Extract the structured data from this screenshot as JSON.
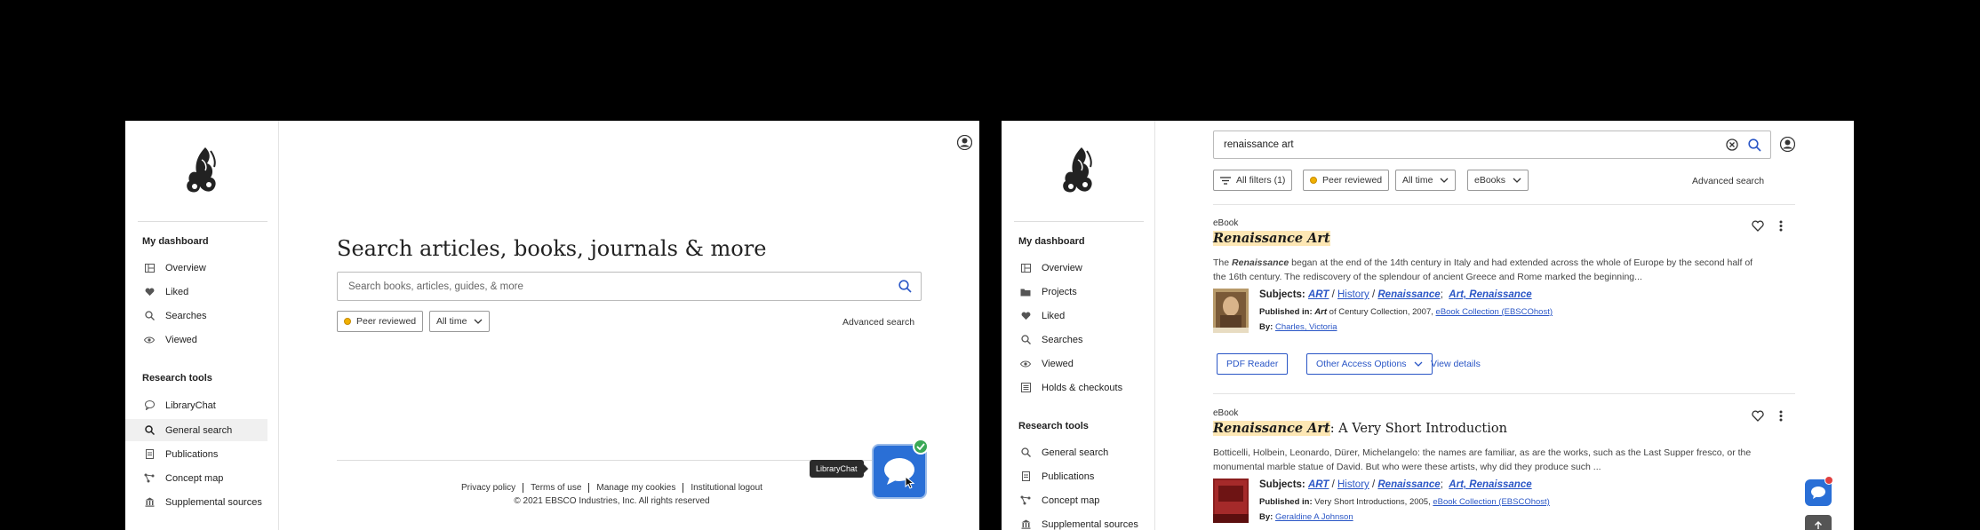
{
  "left": {
    "sidebar": {
      "dashboard_heading": "My dashboard",
      "dashboard_items": [
        {
          "label": "Overview",
          "icon": "overview-icon"
        },
        {
          "label": "Liked",
          "icon": "heart-icon"
        },
        {
          "label": "Searches",
          "icon": "search-history-icon"
        },
        {
          "label": "Viewed",
          "icon": "eye-icon"
        }
      ],
      "tools_heading": "Research tools",
      "tools_items": [
        {
          "label": "LibraryChat",
          "icon": "chat-bubble-icon"
        },
        {
          "label": "General search",
          "icon": "search-icon"
        },
        {
          "label": "Publications",
          "icon": "document-icon"
        },
        {
          "label": "Concept map",
          "icon": "concept-map-icon"
        },
        {
          "label": "Supplemental sources",
          "icon": "library-icon"
        }
      ]
    },
    "main": {
      "title": "Search articles, books, journals & more",
      "search_placeholder": "Search books, articles, guides, & more",
      "filter_peer": "Peer reviewed",
      "filter_time": "All time",
      "advanced_search": "Advanced search"
    },
    "footer": {
      "links": [
        "Privacy policy",
        "Terms of use",
        "Manage my cookies",
        "Institutional logout"
      ],
      "copyright": "© 2021 EBSCO Industries, Inc. All rights reserved"
    },
    "chat": {
      "tooltip": "LibraryChat"
    }
  },
  "right": {
    "sidebar": {
      "dashboard_heading": "My dashboard",
      "dashboard_items": [
        {
          "label": "Overview",
          "icon": "overview-icon"
        },
        {
          "label": "Projects",
          "icon": "folder-icon"
        },
        {
          "label": "Liked",
          "icon": "heart-icon"
        },
        {
          "label": "Searches",
          "icon": "search-history-icon"
        },
        {
          "label": "Viewed",
          "icon": "eye-icon"
        },
        {
          "label": "Holds & checkouts",
          "icon": "holds-icon"
        }
      ],
      "tools_heading": "Research tools",
      "tools_items": [
        {
          "label": "General search",
          "icon": "search-icon"
        },
        {
          "label": "Publications",
          "icon": "document-icon"
        },
        {
          "label": "Concept map",
          "icon": "concept-map-icon"
        },
        {
          "label": "Supplemental sources",
          "icon": "library-icon"
        }
      ]
    },
    "search": {
      "value": "renaissance art"
    },
    "filters": {
      "all_filters": "All filters (1)",
      "peer": "Peer reviewed",
      "time": "All time",
      "type": "eBooks",
      "advanced": "Advanced search"
    },
    "results": [
      {
        "type": "eBook",
        "title_hl": "Renaissance Art",
        "title_rest": "",
        "abstract_pre": "The ",
        "abstract_hl": "Renaissance",
        "abstract_post": " began at the end of the 14th century in Italy and had extended across the whole of Europe by the second half of the 16th century. The rediscovery of the splendour of ancient Greece and Rome marked the beginning...",
        "subjects_label": "Subjects:",
        "subj_art": "ART",
        "subj_history": "History",
        "subj_ren": "Renaissance",
        "subj_art2": "Art, Renaissance",
        "published_label": "Published in:",
        "published_art": "Art",
        "published_rest": " of Century Collection, 2007,",
        "published_link": "eBook Collection (EBSCOhost)",
        "by_label": "By:",
        "author": "Charles, Victoria",
        "pdf_button": "PDF Reader",
        "access_button": "Other Access Options",
        "view_details": "View details"
      },
      {
        "type": "eBook",
        "title_hl": "Renaissance Art",
        "title_rest": ": A Very Short Introduction",
        "abstract_text": "Botticelli, Holbein, Leonardo, Dürer, Michelangelo: the names are familiar, as are the works, such as the Last Supper fresco, or the monumental marble statue of David. But who were these artists, why did they produce such ...",
        "subjects_label": "Subjects:",
        "subj_art": "ART",
        "subj_history": "History",
        "subj_ren": "Renaissance",
        "subj_art2": "Art, Renaissance",
        "published_label": "Published in:",
        "published_rest": "Very Short Introductions, 2005,",
        "published_link": "eBook Collection (EBSCOhost)",
        "by_label": "By:",
        "author": "Geraldine A Johnson"
      }
    ]
  },
  "colors": {
    "accent": "#2a56c6",
    "chat": "#2a6fd6",
    "highlight": "#fde7b4",
    "peer_dot": "#f0b000",
    "success": "#3aa856"
  }
}
